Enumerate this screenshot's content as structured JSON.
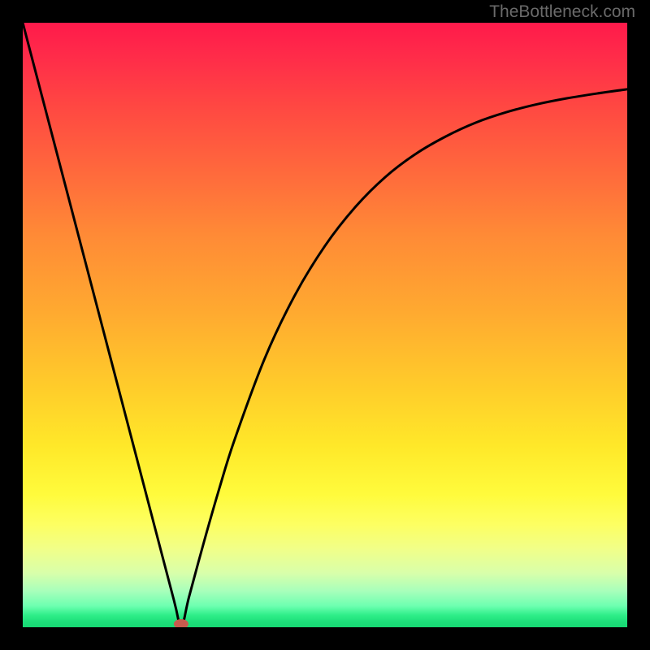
{
  "watermark": "TheBottleneck.com",
  "chart_data": {
    "type": "line",
    "title": "",
    "xlabel": "",
    "ylabel": "",
    "xlim": [
      0,
      1
    ],
    "ylim": [
      0,
      1
    ],
    "series": [
      {
        "name": "bottleneck-curve",
        "x": [
          0.0,
          0.05,
          0.1,
          0.15,
          0.2,
          0.25,
          0.262,
          0.275,
          0.3,
          0.325,
          0.35,
          0.4,
          0.45,
          0.5,
          0.55,
          0.6,
          0.65,
          0.7,
          0.75,
          0.8,
          0.85,
          0.9,
          0.95,
          1.0
        ],
        "y": [
          1.0,
          0.809,
          0.618,
          0.427,
          0.236,
          0.045,
          0.0,
          0.05,
          0.142,
          0.229,
          0.309,
          0.444,
          0.549,
          0.631,
          0.695,
          0.745,
          0.783,
          0.812,
          0.835,
          0.852,
          0.865,
          0.875,
          0.883,
          0.89
        ]
      }
    ],
    "minimum_point": {
      "x": 0.262,
      "y": 0.0
    },
    "gradient": {
      "top": "#ff1a4b",
      "mid_upper": "#ff8a36",
      "mid_lower": "#fffb3c",
      "bottom": "#17d873"
    },
    "marker_color": "#c85a4e",
    "curve_color": "#000000"
  }
}
